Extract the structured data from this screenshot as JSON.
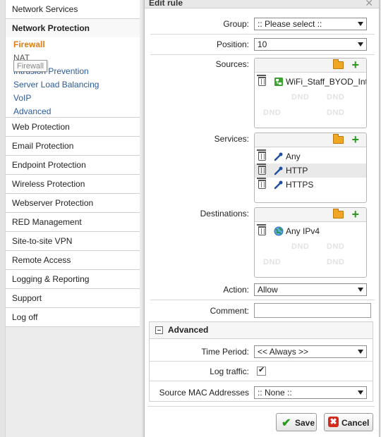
{
  "sidebar": {
    "top_item": "Network Services",
    "section_title": "Network Protection",
    "sub_items": [
      "Firewall",
      "NAT",
      "Intrusion Prevention",
      "Server Load Balancing",
      "VoIP",
      "Advanced"
    ],
    "tooltip": "Firewall",
    "items": [
      "Web Protection",
      "Email Protection",
      "Endpoint Protection",
      "Wireless Protection",
      "Webserver Protection",
      "RED Management",
      "Site-to-site VPN",
      "Remote Access",
      "Logging & Reporting",
      "Support",
      "Log off"
    ]
  },
  "dialog": {
    "title": "Edit rule",
    "group": {
      "label": "Group:",
      "value": ":: Please select ::"
    },
    "position": {
      "label": "Position:",
      "value": "10"
    },
    "sources": {
      "label": "Sources:",
      "items": [
        "WiFi_Staff_BYOD_Int"
      ]
    },
    "services": {
      "label": "Services:",
      "items": [
        "Any",
        "HTTP",
        "HTTPS"
      ]
    },
    "destinations": {
      "label": "Destinations:",
      "items": [
        "Any IPv4"
      ]
    },
    "dnd": "DND",
    "action": {
      "label": "Action:",
      "value": "Allow"
    },
    "comment": {
      "label": "Comment:",
      "value": ""
    },
    "advanced": {
      "title": "Advanced",
      "time_period": {
        "label": "Time Period:",
        "value": "<< Always >>"
      },
      "log_traffic": {
        "label": "Log traffic:",
        "checked": true
      },
      "source_mac": {
        "label": "Source MAC Addresses",
        "value": ":: None ::"
      }
    },
    "save_label": "Save",
    "cancel_label": "Cancel"
  },
  "colors": {
    "active_menu": "#e07c14",
    "link": "#2b5a9b",
    "add": "#2a9a1f",
    "cancel": "#d42a1e"
  }
}
